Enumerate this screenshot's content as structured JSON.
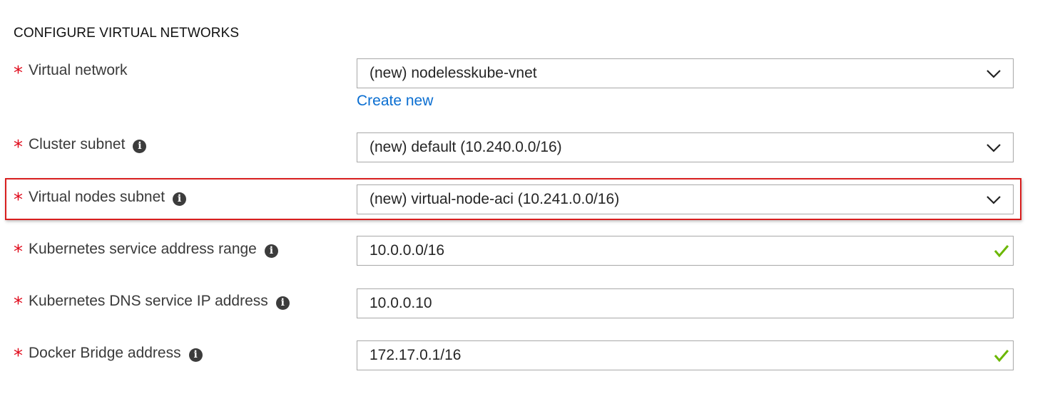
{
  "section": {
    "title": "CONFIGURE VIRTUAL NETWORKS"
  },
  "required_marker": "*",
  "info_glyph": "i",
  "fields": {
    "virtual_network": {
      "label": "Virtual network",
      "value": "(new) nodelesskube-vnet",
      "link": "Create new"
    },
    "cluster_subnet": {
      "label": "Cluster subnet",
      "value": "(new) default (10.240.0.0/16)"
    },
    "virtual_nodes_subnet": {
      "label": "Virtual nodes subnet",
      "value": "(new) virtual-node-aci (10.241.0.0/16)"
    },
    "service_address_range": {
      "label": "Kubernetes service address range",
      "value": "10.0.0.0/16",
      "valid": true
    },
    "dns_service_ip": {
      "label": "Kubernetes DNS service IP address",
      "value": "10.0.0.10"
    },
    "docker_bridge": {
      "label": "Docker Bridge address",
      "value": "172.17.0.1/16",
      "valid": true
    }
  },
  "colors": {
    "required": "#e00b1c",
    "link": "#0a6ed1",
    "valid_check": "#6bb700",
    "highlight_border": "#d81e1e"
  },
  "icons": [
    "info-icon",
    "chevron-down-icon",
    "checkmark-icon"
  ]
}
